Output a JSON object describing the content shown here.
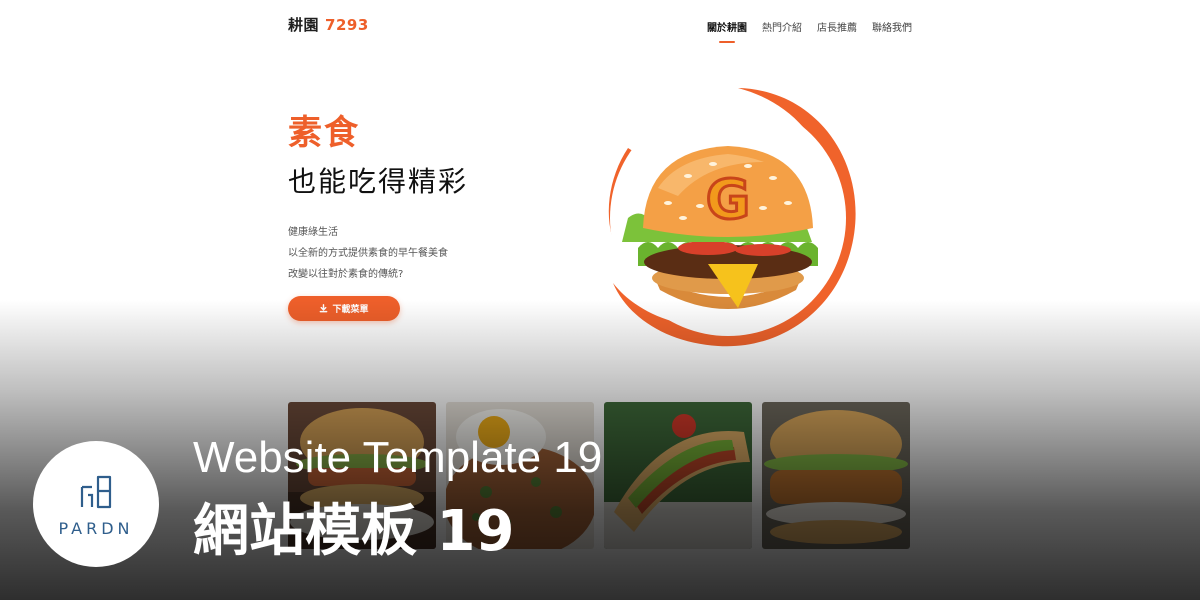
{
  "brand": {
    "name": "耕園",
    "number": "7293"
  },
  "nav": {
    "items": [
      {
        "label": "關於耕園",
        "active": true
      },
      {
        "label": "熱門介紹",
        "active": false
      },
      {
        "label": "店長推薦",
        "active": false
      },
      {
        "label": "聯絡我們",
        "active": false
      }
    ]
  },
  "hero": {
    "title": "素食",
    "subtitle": "也能吃得精彩",
    "lines": [
      "健康綠生活",
      "以全新的方式提供素食的早午餐美食",
      "改變以往對於素食的傳統?"
    ],
    "button_label": "下載菜單",
    "button_icon": "download-icon",
    "art_letter": "G"
  },
  "cards": [
    {
      "name": "burger-with-sausage"
    },
    {
      "name": "fried-egg-rice"
    },
    {
      "name": "hot-dog"
    },
    {
      "name": "crispy-chicken-burger"
    }
  ],
  "overlay": {
    "logo_text": "PARDN",
    "caption_en": "Website Template 19",
    "caption_zh": "網站模板 19"
  },
  "colors": {
    "accent": "#ee5f2a",
    "logo_blue": "#2f5e8c"
  }
}
